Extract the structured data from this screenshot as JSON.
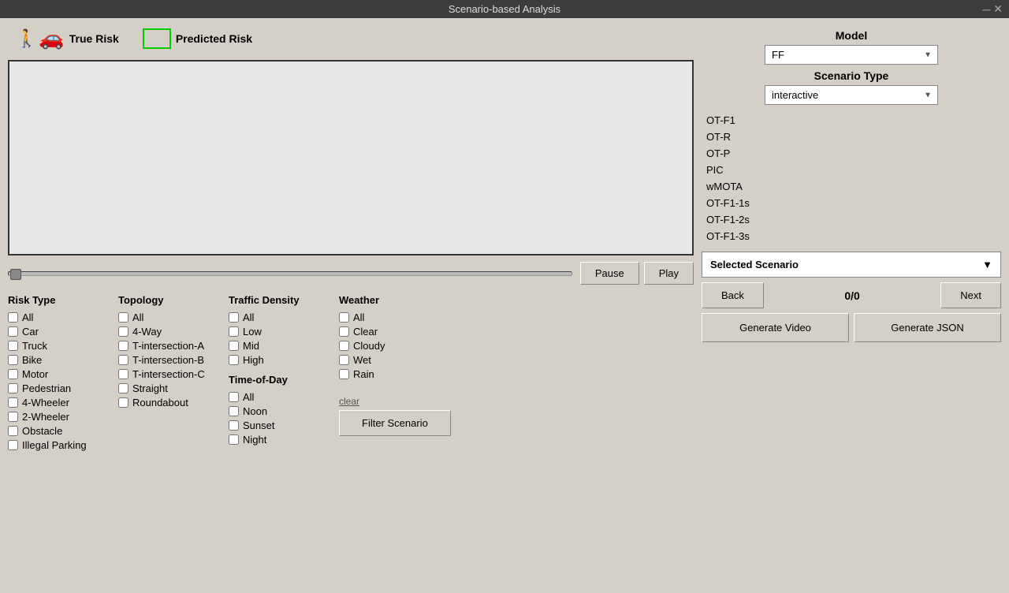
{
  "titleBar": {
    "title": "Scenario-based Analysis"
  },
  "legend": {
    "trueRisk": "True Risk",
    "predictedRisk": "Predicted Risk"
  },
  "controls": {
    "pauseLabel": "Pause",
    "playLabel": "Play"
  },
  "riskType": {
    "title": "Risk Type",
    "items": [
      "All",
      "Car",
      "Truck",
      "Bike",
      "Motor",
      "Pedestrian",
      "4-Wheeler",
      "2-Wheeler",
      "Obstacle",
      "Illegal Parking"
    ]
  },
  "topology": {
    "title": "Topology",
    "items": [
      "All",
      "4-Way",
      "T-intersection-A",
      "T-intersection-B",
      "T-intersection-C",
      "Straight",
      "Roundabout"
    ]
  },
  "trafficDensity": {
    "title": "Traffic Density",
    "items": [
      "All",
      "Low",
      "Mid",
      "High"
    ]
  },
  "weather": {
    "title": "Weather",
    "items": [
      "All",
      "Clear",
      "Cloudy",
      "Wet",
      "Rain"
    ]
  },
  "timeOfDay": {
    "title": "Time-of-Day",
    "items": [
      "All",
      "Noon",
      "Sunset",
      "Night"
    ]
  },
  "filterBtn": "Filter Scenario",
  "clearText": "clear",
  "rightPanel": {
    "modelLabel": "Model",
    "modelValue": "FF",
    "scenarioTypeLabel": "Scenario Type",
    "scenarioTypeValue": "interactive",
    "metrics": [
      "OT-F1",
      "OT-R",
      "OT-P",
      "PIC",
      "wMOTA",
      "OT-F1-1s",
      "OT-F1-2s",
      "OT-F1-3s"
    ],
    "selectedScenario": "Selected Scenario",
    "backLabel": "Back",
    "nextLabel": "Next",
    "pageCount": "0/0",
    "generateVideoLabel": "Generate Video",
    "generateJsonLabel": "Generate JSON"
  }
}
